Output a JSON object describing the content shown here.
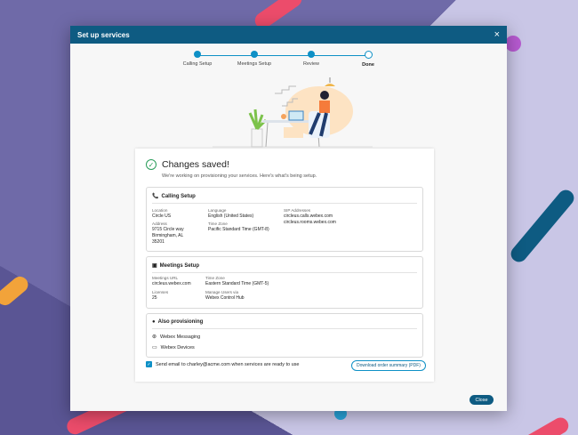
{
  "modal": {
    "title": "Set up services",
    "close_icon": "×"
  },
  "stepper": {
    "steps": [
      "Calling Setup",
      "Meetings Setup",
      "Review",
      "Done"
    ]
  },
  "card": {
    "heading": "Changes saved!",
    "subtitle": "We're working on provisioning your services. Here's what's being setup.",
    "calling": {
      "title": "Calling Setup",
      "location_label": "Location",
      "location": "Circle US",
      "address_label": "Address",
      "address1": "9715 Circle way",
      "address2": "Birmingham, AL",
      "address3": "35201",
      "language_label": "Language",
      "language": "English (United States)",
      "timezone_label": "Time Zone",
      "timezone": "Pacific Standard Time (GMT-8)",
      "sip_label": "SIP Addresses",
      "sip1": "circleus.calls.webex.com",
      "sip2": "circleus.rooms.webex.com"
    },
    "meetings": {
      "title": "Meetings Setup",
      "url_label": "Meetings URL",
      "url": "circleus.webex.com",
      "licenses_label": "Licenses",
      "licenses": "25",
      "timezone_label": "Time Zone",
      "timezone": "Eastern Standard Time (GMT-5)",
      "manage_label": "Manage Users via",
      "manage": "Webex Control Hub"
    },
    "also": {
      "title": "Also provisioning",
      "items": [
        "Webex Messaging",
        "Webex Devices"
      ]
    },
    "email_label": "Send email to charley@acme.com when services are ready to use",
    "email_checked": true,
    "download_label": "Download order summary (PDF)"
  },
  "footer": {
    "close_label": "Close"
  },
  "colors": {
    "accent": "#0e5b82",
    "step": "#0e90c6",
    "success": "#2a9d5a"
  }
}
